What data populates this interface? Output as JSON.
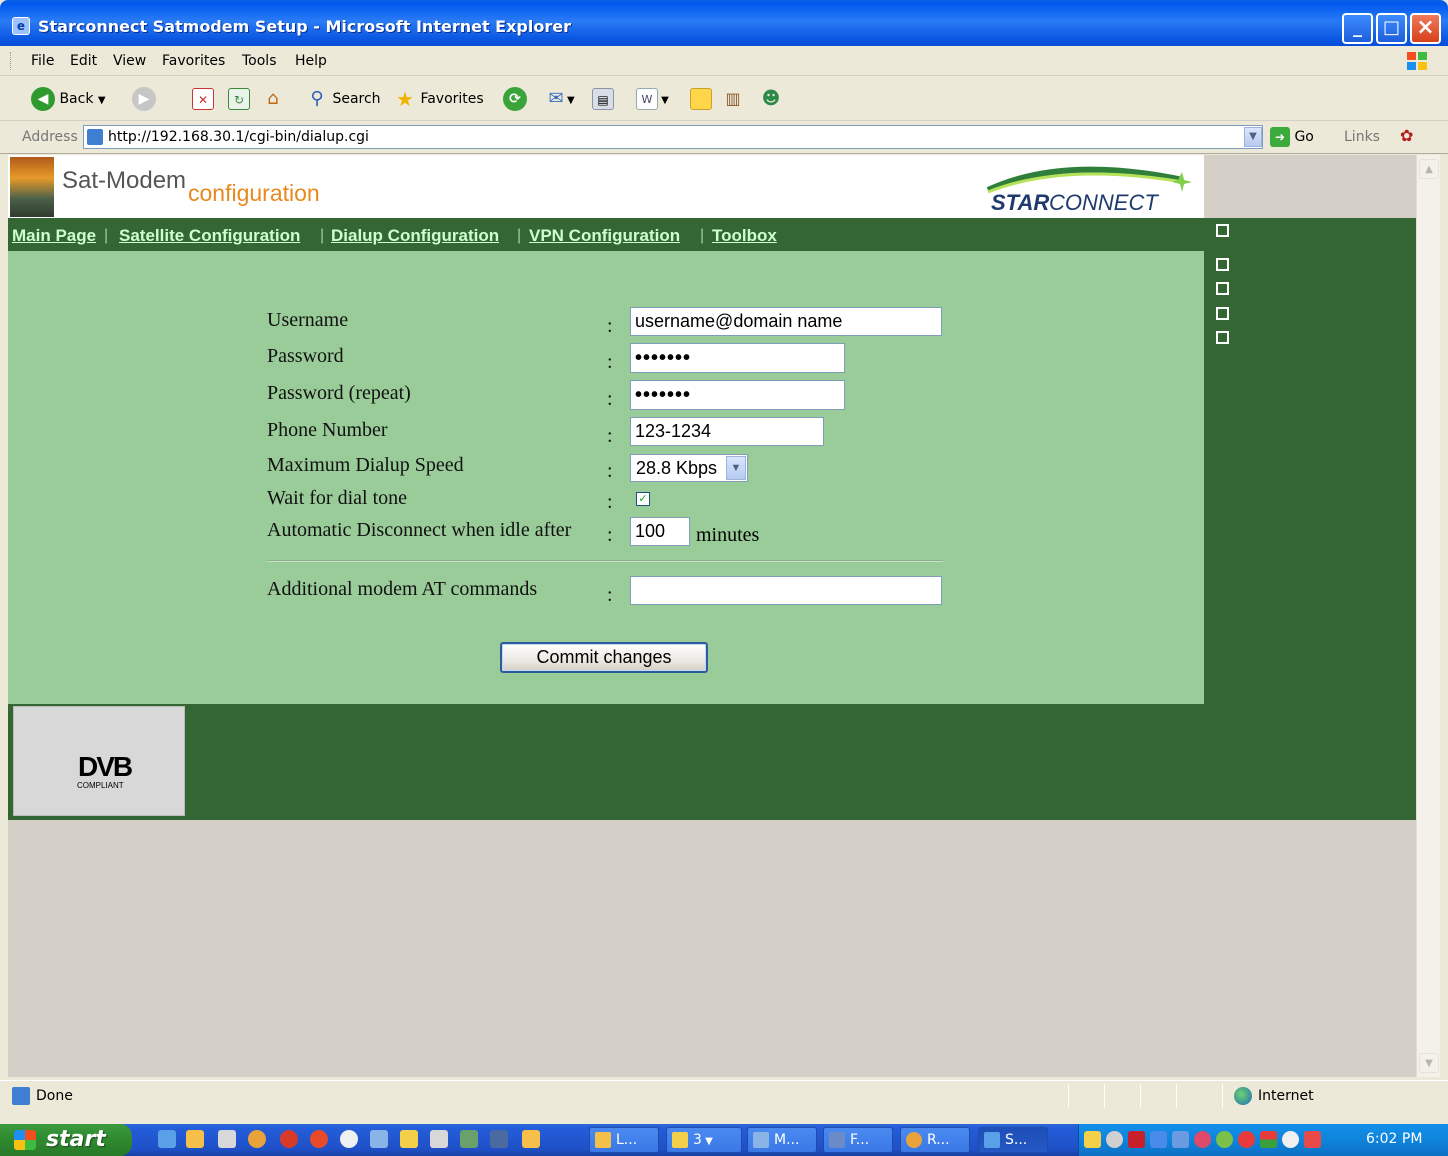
{
  "window": {
    "title": "Starconnect Satmodem Setup - Microsoft Internet Explorer"
  },
  "menu": [
    "File",
    "Edit",
    "View",
    "Favorites",
    "Tools",
    "Help"
  ],
  "toolbar": {
    "back_label": "Back",
    "search_label": "Search",
    "favorites_label": "Favorites"
  },
  "address": {
    "label": "Address",
    "url": "http://192.168.30.1/cgi-bin/dialup.cgi",
    "go_label": "Go",
    "links_label": "Links"
  },
  "header": {
    "logo_main": "Sat-Modem",
    "logo_sub": "configuration",
    "brand_star": "STAR",
    "brand_connect": "CONNECT"
  },
  "nav": {
    "items": [
      "Main Page",
      "Satellite Configuration",
      "Dialup Configuration",
      "VPN Configuration",
      "Toolbox"
    ],
    "separator": "|"
  },
  "form": {
    "colon": ":",
    "username": {
      "label": "Username",
      "value": "username@domain name"
    },
    "password": {
      "label": "Password",
      "value": "•••••••"
    },
    "password_repeat": {
      "label": "Password (repeat)",
      "value": "•••••••"
    },
    "phone": {
      "label": "Phone Number",
      "value": "123-1234"
    },
    "speed": {
      "label": "Maximum Dialup Speed",
      "value": "28.8 Kbps"
    },
    "dialtone": {
      "label": "Wait for dial tone",
      "checked": true
    },
    "idle": {
      "label": "Automatic Disconnect when idle after",
      "value": "100",
      "unit": "minutes"
    },
    "at_commands": {
      "label": "Additional modem AT commands",
      "value": ""
    },
    "commit_label": "Commit changes"
  },
  "footer": {
    "dvb_main": "DVB",
    "dvb_sub": "COMPLIANT"
  },
  "status": {
    "text": "Done",
    "zone": "Internet"
  },
  "taskbar": {
    "start_label": "start",
    "tasks": [
      "L...",
      "3",
      "M...",
      "F...",
      "R...",
      "S..."
    ],
    "clock": "6:02 PM"
  },
  "colors": {
    "nav_green": "#336633",
    "form_green": "#99cc99",
    "brand_orange": "#e8891e"
  }
}
